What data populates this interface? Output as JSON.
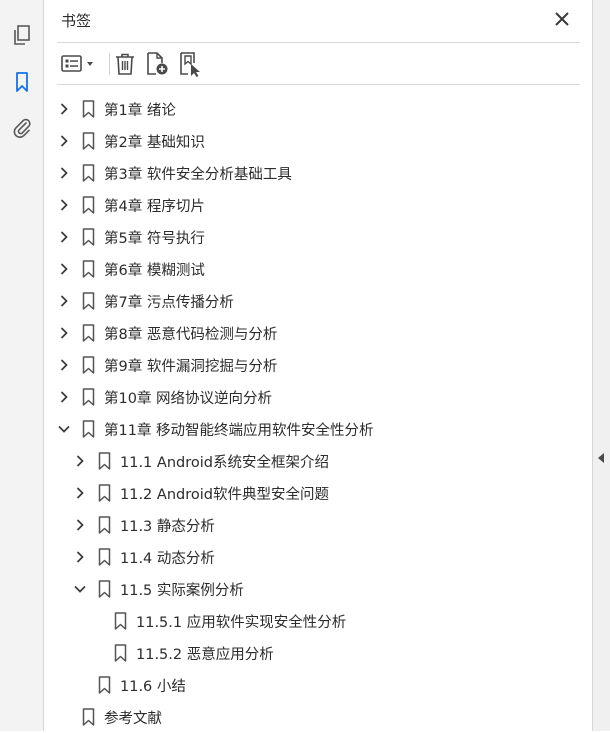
{
  "panel": {
    "title": "书签"
  },
  "rail": {
    "icons": [
      "pages-icon",
      "bookmark-icon",
      "attachment-icon"
    ],
    "active": "bookmark-icon",
    "accent": "#1473e6"
  },
  "bookmarks": [
    {
      "label": "第1章 绪论",
      "level": 0,
      "state": "collapsed"
    },
    {
      "label": "第2章 基础知识",
      "level": 0,
      "state": "collapsed"
    },
    {
      "label": "第3章 软件安全分析基础工具",
      "level": 0,
      "state": "collapsed"
    },
    {
      "label": "第4章 程序切片",
      "level": 0,
      "state": "collapsed"
    },
    {
      "label": "第5章 符号执行",
      "level": 0,
      "state": "collapsed"
    },
    {
      "label": "第6章 模糊测试",
      "level": 0,
      "state": "collapsed"
    },
    {
      "label": "第7章 污点传播分析",
      "level": 0,
      "state": "collapsed"
    },
    {
      "label": "第8章 恶意代码检测与分析",
      "level": 0,
      "state": "collapsed"
    },
    {
      "label": "第9章 软件漏洞挖掘与分析",
      "level": 0,
      "state": "collapsed"
    },
    {
      "label": "第10章 网络协议逆向分析",
      "level": 0,
      "state": "collapsed"
    },
    {
      "label": "第11章 移动智能终端应用软件安全性分析",
      "level": 0,
      "state": "expanded"
    },
    {
      "label": "11.1 Android系统安全框架介绍",
      "level": 1,
      "state": "collapsed"
    },
    {
      "label": "11.2 Android软件典型安全问题",
      "level": 1,
      "state": "collapsed"
    },
    {
      "label": "11.3 静态分析",
      "level": 1,
      "state": "collapsed"
    },
    {
      "label": "11.4 动态分析",
      "level": 1,
      "state": "collapsed"
    },
    {
      "label": "11.5 实际案例分析",
      "level": 1,
      "state": "expanded"
    },
    {
      "label": "11.5.1 应用软件实现安全性分析",
      "level": 2,
      "state": "leaf"
    },
    {
      "label": "11.5.2 恶意应用分析",
      "level": 2,
      "state": "leaf"
    },
    {
      "label": "11.6 小结",
      "level": 1,
      "state": "leaf"
    },
    {
      "label": "参考文献",
      "level": 0,
      "state": "leaf"
    }
  ]
}
